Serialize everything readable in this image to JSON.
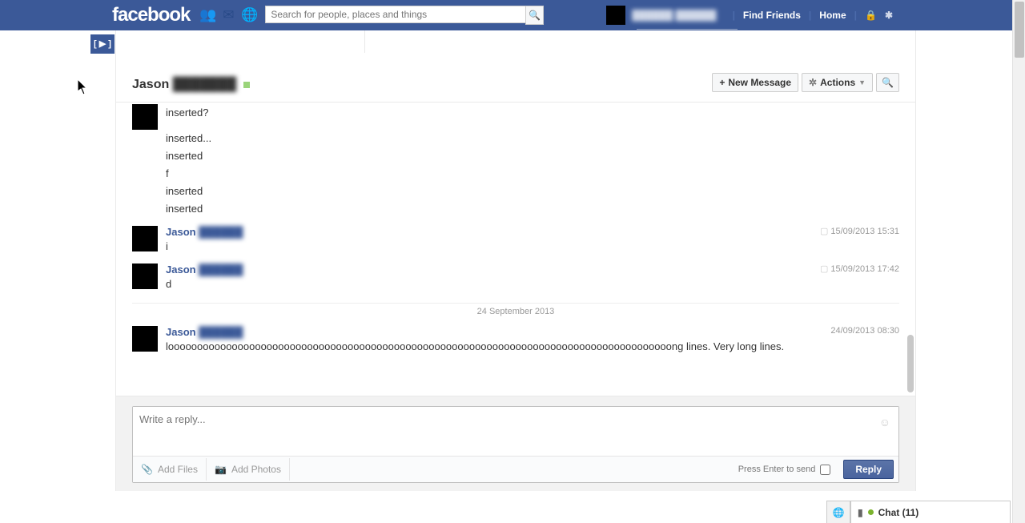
{
  "topbar": {
    "logo": "facebook",
    "search_placeholder": "Search for people, places and things",
    "find_friends": "Find Friends",
    "home": "Home",
    "profile_name": "██████ ██████"
  },
  "bookmark_label": "[ ▶ ]",
  "header": {
    "name_visible": "Jason",
    "name_blur": "███████",
    "new_message": "New Message",
    "actions": "Actions"
  },
  "thread": {
    "first_lines": [
      "inserted?",
      "inserted...",
      "inserted",
      "f",
      "inserted",
      "inserted"
    ],
    "groups": [
      {
        "name_visible": "Jason",
        "name_blur": "██████",
        "ts": "15/09/2013 15:31",
        "lines": [
          "i"
        ]
      },
      {
        "name_visible": "Jason",
        "name_blur": "██████",
        "ts": "15/09/2013 17:42",
        "lines": [
          "d"
        ]
      }
    ],
    "date_divider": "24 September 2013",
    "last": {
      "name_visible": "Jason",
      "name_blur": "██████",
      "ts": "24/09/2013 08:30",
      "text": "looooooooooooooooooooooooooooooooooooooooooooooooooooooooooooooooooooooooooooooooooooooong lines. Very long lines."
    }
  },
  "reply": {
    "placeholder": "Write a reply...",
    "add_files": "Add Files",
    "add_photos": "Add Photos",
    "enter_label": "Press Enter to send",
    "button": "Reply"
  },
  "chat": {
    "label": "Chat (11)"
  }
}
